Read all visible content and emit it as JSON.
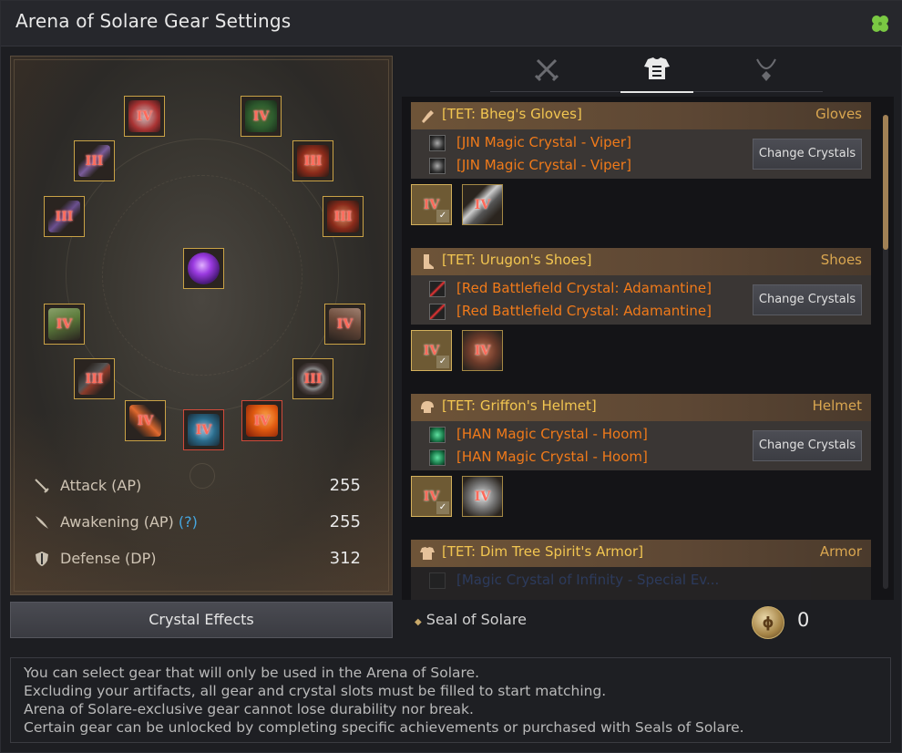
{
  "window": {
    "title": "Arena of Solare Gear Settings",
    "corner_icon": "clover-icon"
  },
  "gear_slots": [
    {
      "name": "chest-armor",
      "tier": "IV",
      "color": "#a33"
    },
    {
      "name": "tree-armor",
      "tier": "IV",
      "color": "#2d5a2d"
    },
    {
      "name": "dagger-left",
      "tier": "III",
      "color": "#7a5c9a"
    },
    {
      "name": "helmet-red",
      "tier": "III",
      "color": "#8a2a1a"
    },
    {
      "name": "dagger-left-2",
      "tier": "III",
      "color": "#6b5090"
    },
    {
      "name": "helmet-red-2",
      "tier": "III",
      "color": "#8a2a1a"
    },
    {
      "name": "center-crystal",
      "tier": "",
      "color": "#7a2bbf"
    },
    {
      "name": "shoes-left",
      "tier": "IV",
      "color": "#5a7a3a"
    },
    {
      "name": "gloves-right",
      "tier": "IV",
      "color": "#6a4a3a"
    },
    {
      "name": "belt-left",
      "tier": "III",
      "color": "#3a3a3a"
    },
    {
      "name": "ring-right",
      "tier": "III",
      "color": "#4a4040"
    },
    {
      "name": "dagger-bottom",
      "tier": "IV",
      "color": "#a04a20"
    },
    {
      "name": "gauntlet-bottom",
      "tier": "IV",
      "color": "#2a6a8a"
    },
    {
      "name": "flame-bottom",
      "tier": "IV",
      "color": "#d04a10"
    }
  ],
  "stats": [
    {
      "label": "Attack (AP)",
      "value": "255",
      "icon": "sword-icon"
    },
    {
      "label": "Awakening (AP)",
      "help": "(?)",
      "value": "255",
      "icon": "awakening-blade-icon"
    },
    {
      "label": "Defense (DP)",
      "value": "312",
      "icon": "shield-icon"
    }
  ],
  "crystal_effects_button": "Crystal Effects",
  "tabs": [
    {
      "name": "weapons",
      "icon": "crossed-swords-icon",
      "active": false
    },
    {
      "name": "armor",
      "icon": "armor-icon",
      "active": true
    },
    {
      "name": "accessories",
      "icon": "necklace-icon",
      "active": false
    }
  ],
  "gear_cards": [
    {
      "name": "[TET: Bheg's Gloves]",
      "type": "Gloves",
      "icon": "gloves-icon",
      "crystals": [
        "[JIN Magic Crystal - Viper]",
        "[JIN Magic Crystal - Viper]"
      ],
      "crystal_icon": "viper-crystal-icon",
      "change_label": "Change Crystals",
      "options": [
        {
          "tier": "IV",
          "selected": true
        },
        {
          "tier": "IV",
          "selected": false
        }
      ]
    },
    {
      "name": "[TET: Urugon's Shoes]",
      "type": "Shoes",
      "icon": "shoes-icon",
      "crystals": [
        "[Red Battlefield Crystal: Adamantine]",
        "[Red Battlefield Crystal: Adamantine]"
      ],
      "crystal_icon": "adamantine-crystal-icon",
      "change_label": "Change Crystals",
      "options": [
        {
          "tier": "IV",
          "selected": true
        },
        {
          "tier": "IV",
          "selected": false
        }
      ]
    },
    {
      "name": "[TET: Griffon's Helmet]",
      "type": "Helmet",
      "icon": "helmet-icon",
      "crystals": [
        "[HAN Magic Crystal - Hoom]",
        "[HAN Magic Crystal - Hoom]"
      ],
      "crystal_icon": "hoom-crystal-icon",
      "change_label": "Change Crystals",
      "options": [
        {
          "tier": "IV",
          "selected": true
        },
        {
          "tier": "IV",
          "selected": false
        }
      ]
    },
    {
      "name": "[TET: Dim Tree Spirit's Armor]",
      "type": "Armor",
      "icon": "armor-icon",
      "crystals": [
        "[Magic Crystal of Infinity - Special Ev..."
      ],
      "crystal_icon": "infinity-crystal-icon",
      "change_label": "",
      "options": []
    }
  ],
  "seal": {
    "label": "Seal of Solare",
    "count": "0",
    "icon": "seal-coin-icon",
    "coin_glyph": "ϕ"
  },
  "info_lines": [
    "You can select gear that will only be used in the Arena of Solare.",
    "Excluding your artifacts, all gear and crystal slots must be filled to start matching.",
    "Arena of Solare-exclusive gear cannot lose durability nor break.",
    "Certain gear can be unlocked by completing specific achievements or purchased with Seals of Solare."
  ],
  "bullet": "◆"
}
